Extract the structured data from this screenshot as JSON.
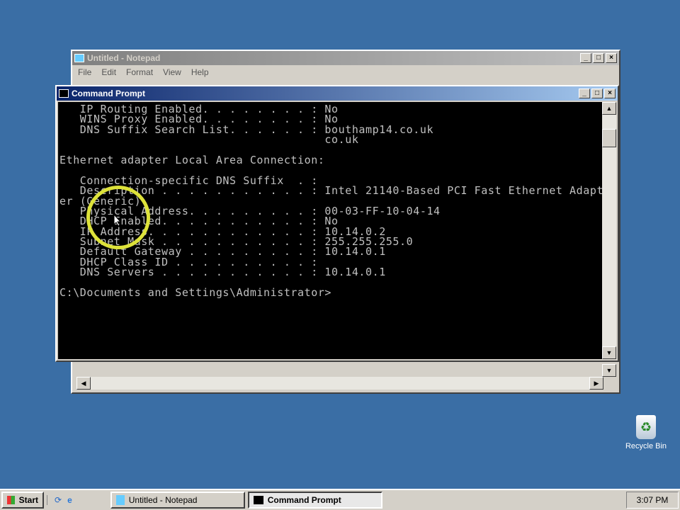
{
  "notepad": {
    "title": "Untitled - Notepad",
    "menu": [
      "File",
      "Edit",
      "Format",
      "View",
      "Help"
    ]
  },
  "cmd": {
    "title": "Command Prompt",
    "lines": [
      "   IP Routing Enabled. . . . . . . . : No",
      "   WINS Proxy Enabled. . . . . . . . : No",
      "   DNS Suffix Search List. . . . . . : bouthamp14.co.uk",
      "                                       co.uk",
      "",
      "Ethernet adapter Local Area Connection:",
      "",
      "   Connection-specific DNS Suffix  . :",
      "   Description . . . . . . . . . . . : Intel 21140-Based PCI Fast Ethernet Adapt",
      "er (Generic)",
      "   Physical Address. . . . . . . . . : 00-03-FF-10-04-14",
      "   DHCP Enabled. . . . . . . . . . . : No",
      "   IP Address. . . . . . . . . . . . : 10.14.0.2",
      "   Subnet Mask . . . . . . . . . . . : 255.255.255.0",
      "   Default Gateway . . . . . . . . . : 10.14.0.1",
      "   DHCP Class ID . . . . . . . . . . :",
      "   DNS Servers . . . . . . . . . . . : 10.14.0.1",
      "",
      "C:\\Documents and Settings\\Administrator>"
    ]
  },
  "desktop": {
    "recycle_bin": "Recycle Bin"
  },
  "taskbar": {
    "start": "Start",
    "items": [
      "Untitled - Notepad",
      "Command Prompt"
    ],
    "clock": "3:07 PM"
  }
}
